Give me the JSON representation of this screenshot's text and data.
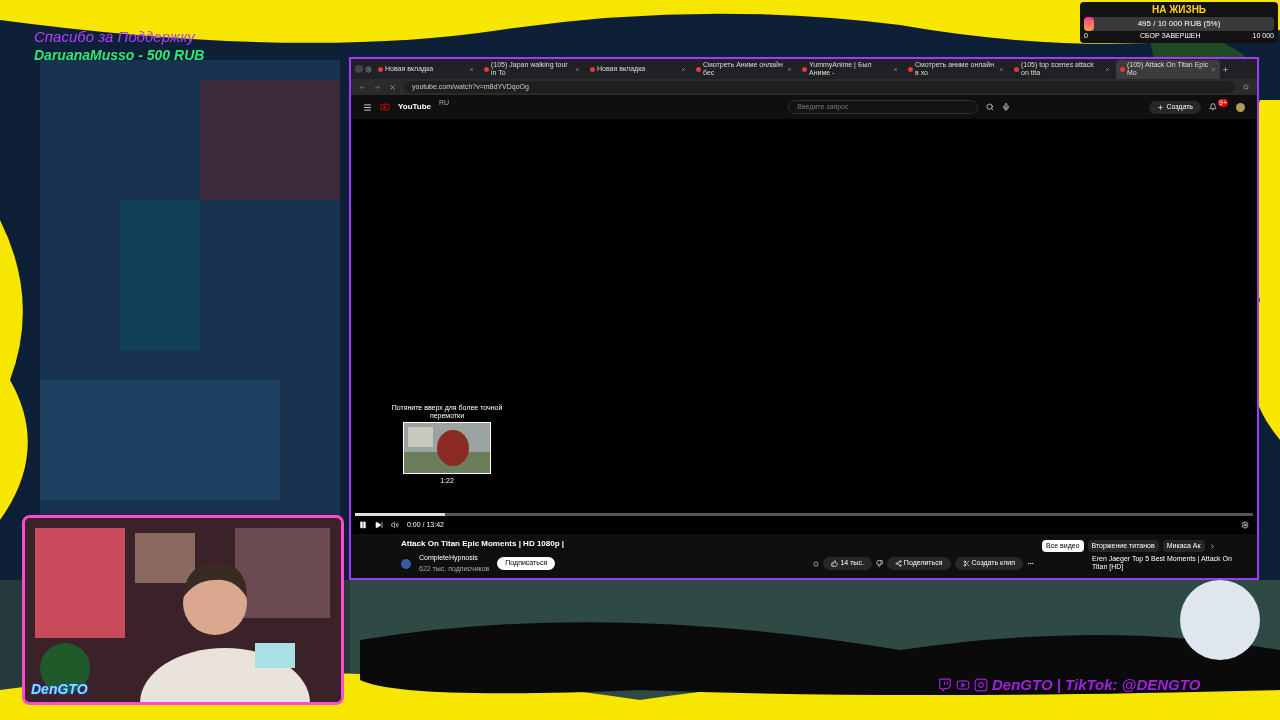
{
  "donation_alert": {
    "title": "Спасибо за Поддержку",
    "message": "DaruanaMusso - 500 RUB"
  },
  "goal": {
    "title": "НА ЖИЗНЬ",
    "reading": "495 / 10 000 RUB (5%)",
    "level": 0.05,
    "min": "0",
    "caption": "СБОР ЗАВЕРШЕН",
    "max": "10 000"
  },
  "browser": {
    "tabs": [
      {
        "title": "Новая вкладка",
        "selected": false
      },
      {
        "title": "(105) Japan walking tour in To",
        "selected": false
      },
      {
        "title": "Новая вкладка",
        "selected": false
      },
      {
        "title": "Смотреть Аниме онлайн бес",
        "selected": false
      },
      {
        "title": "YummyAnime | Был Аниме -",
        "selected": false
      },
      {
        "title": "Смотреть аниме онлайн в хо",
        "selected": false
      },
      {
        "title": "(105) top scenes attack on tita",
        "selected": false
      },
      {
        "title": "(105) Attack On Titan Epic Mo",
        "selected": true
      }
    ],
    "url": "youtube.com/watch?v=m8dYVDqoOg"
  },
  "youtube": {
    "logo": "YouTube",
    "region": "RU",
    "search_placeholder": "Введите запрос",
    "create": "Создать",
    "notifications": "9+",
    "preview_hint": "Потяните вверх для более точной перемотки",
    "preview_time": "1:22",
    "playing": true,
    "level": 0.1,
    "time": "0:00 / 13:42",
    "title": "Attack On Titan Epic Moments | HD 1080p |",
    "channel": "CompleteHypnosis",
    "subscribers": "622 тыс. подписчиков",
    "subscribe": "Подписаться",
    "likes": "14 тыс.",
    "share": "Поделиться",
    "clip": "Создать клип",
    "chips": [
      {
        "label": "Все видео",
        "selected": true
      },
      {
        "label": "Вторжение титанов",
        "selected": false
      },
      {
        "label": "Микаса Ак",
        "selected": false
      }
    ],
    "related": "Eren Jaeger Top 5 Best Moments | Attack On Titan [HD]"
  },
  "webcam": {
    "name": "DenGTO"
  },
  "social": {
    "text": "DenGTO | TikTok: @DENGTO"
  }
}
